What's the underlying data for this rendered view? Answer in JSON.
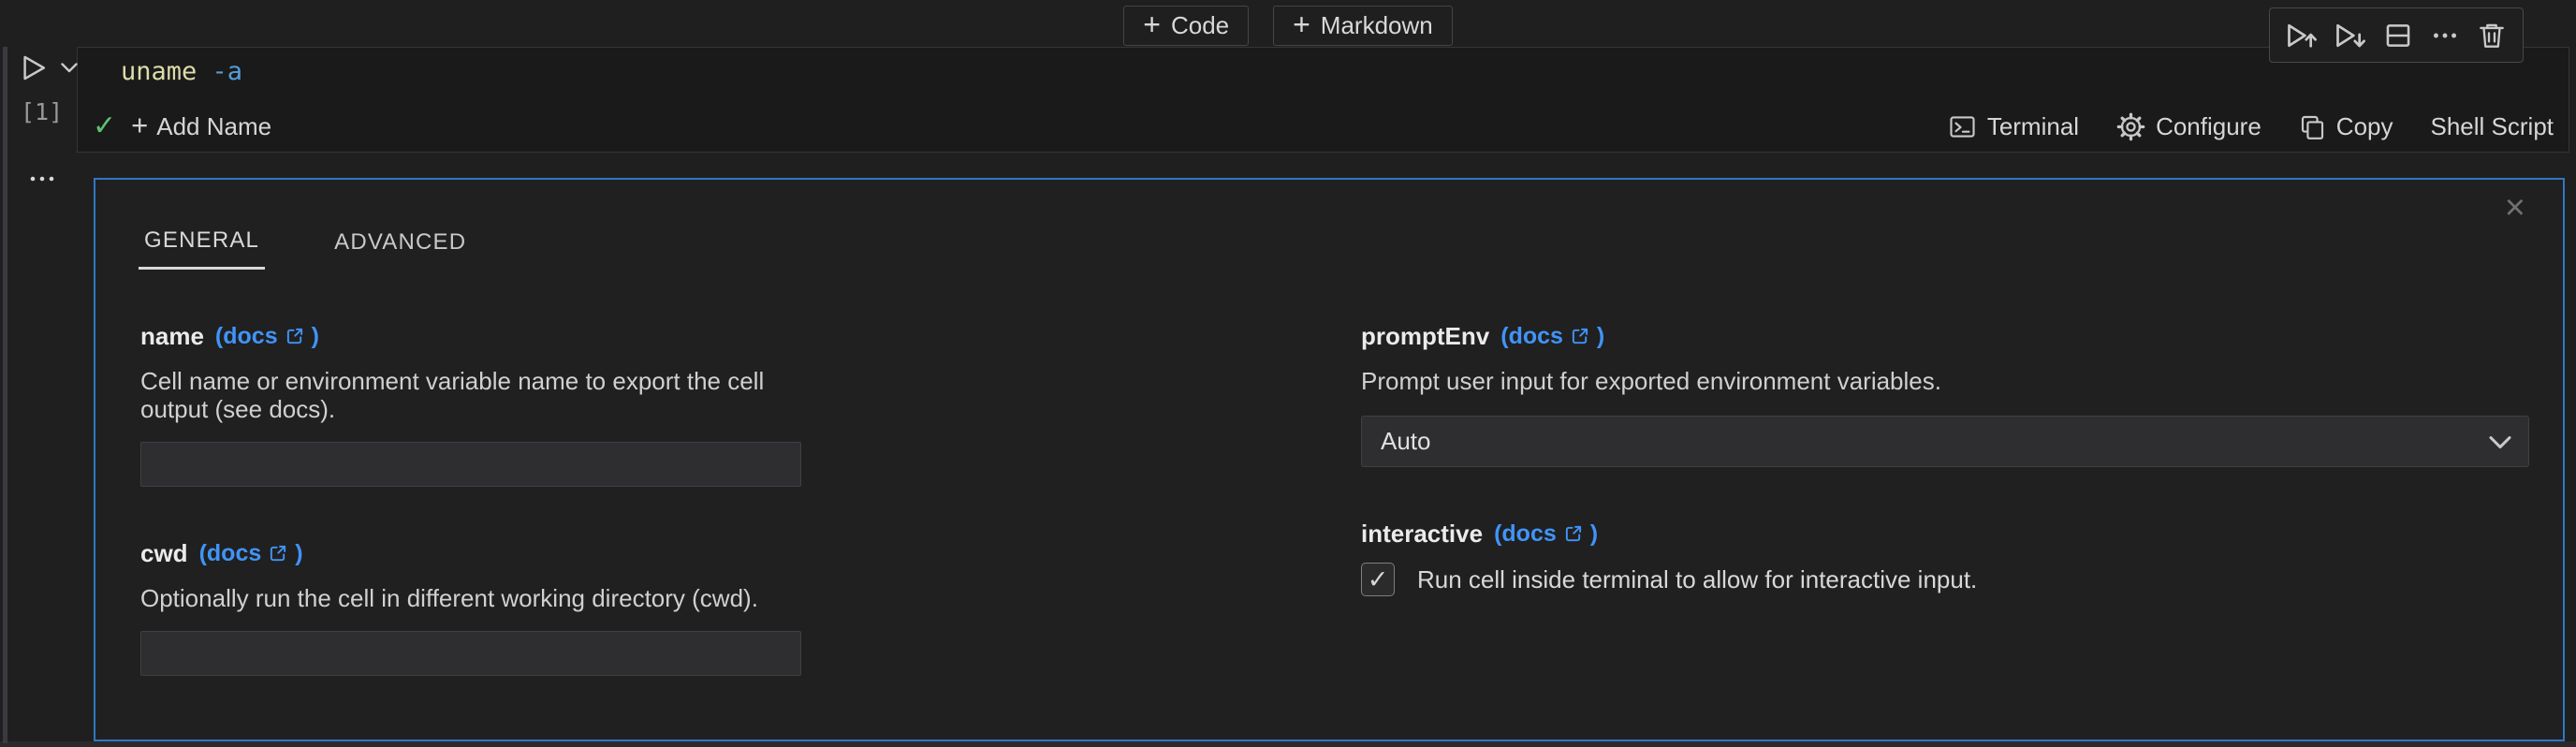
{
  "glyphs": {
    "plus": "+",
    "check": "✓",
    "close": "×",
    "paren_open": "(",
    "paren_close": ")"
  },
  "colors": {
    "panel_border": "#3176c4",
    "link_blue": "#4094f7",
    "code_command_color": "#dcdcaa",
    "code_flag_color": "#569cd6",
    "success_green": "#5fc26d"
  },
  "top_bar": {
    "code_button": "Code",
    "markdown_button": "Markdown"
  },
  "cell": {
    "execution_count": "[1]",
    "code": {
      "command": "uname",
      "flag": "-a"
    },
    "status": {
      "add_name": "Add Name",
      "terminal": "Terminal",
      "configure": "Configure",
      "copy": "Copy",
      "language": "Shell Script"
    }
  },
  "panel": {
    "tabs": {
      "general": "GENERAL",
      "advanced": "ADVANCED"
    },
    "fields": {
      "name": {
        "label": "name",
        "docs": "docs",
        "description": "Cell name or environment variable name to export the cell output (see docs).",
        "value": ""
      },
      "promptEnv": {
        "label": "promptEnv",
        "docs": "docs",
        "description": "Prompt user input for exported environment variables.",
        "value": "Auto"
      },
      "cwd": {
        "label": "cwd",
        "docs": "docs",
        "description": "Optionally run the cell in different working directory (cwd).",
        "value": ""
      },
      "interactive": {
        "label": "interactive",
        "docs": "docs",
        "checkbox_label": "Run cell inside terminal to allow for interactive input.",
        "checked": true
      }
    }
  }
}
